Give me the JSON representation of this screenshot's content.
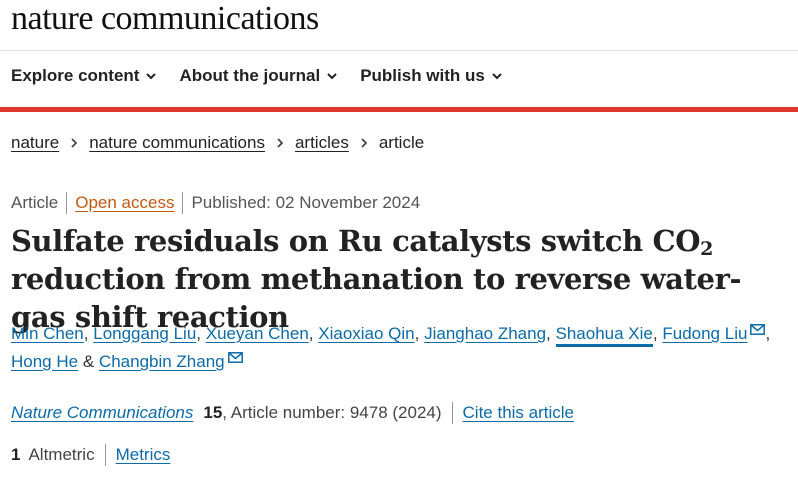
{
  "header": {
    "logo": "nature communications",
    "nav": [
      "Explore content",
      "About the journal",
      "Publish with us"
    ]
  },
  "breadcrumb": [
    "nature",
    "nature communications",
    "articles",
    "article"
  ],
  "meta": {
    "type": "Article",
    "access": "Open access",
    "published": "Published: 02 November 2024"
  },
  "title": {
    "part1": "Sulfate residuals on Ru catalysts switch CO",
    "sub": "2",
    "part2": " reduction from methanation to reverse water-gas shift reaction"
  },
  "authors": [
    "Min Chen",
    "Longgang Liu",
    "Xueyan Chen",
    "Xiaoxiao Qin",
    "Jianghao Zhang",
    "Shaohua Xie",
    "Fudong Liu",
    "Hong He",
    "Changbin Zhang"
  ],
  "authors_text": {
    "comma": ",",
    "and": "&"
  },
  "citation": {
    "journal": "Nature Communications",
    "volume": "15",
    "article": ", Article number: 9478 (2024)",
    "cite": "Cite this article"
  },
  "metrics": {
    "count": "1",
    "altmetric": "Altmetric",
    "link": "Metrics"
  },
  "colors": {
    "accent_red": "#e0382c",
    "link_blue": "#0c6ba8",
    "open_access_orange": "#c05a13"
  }
}
